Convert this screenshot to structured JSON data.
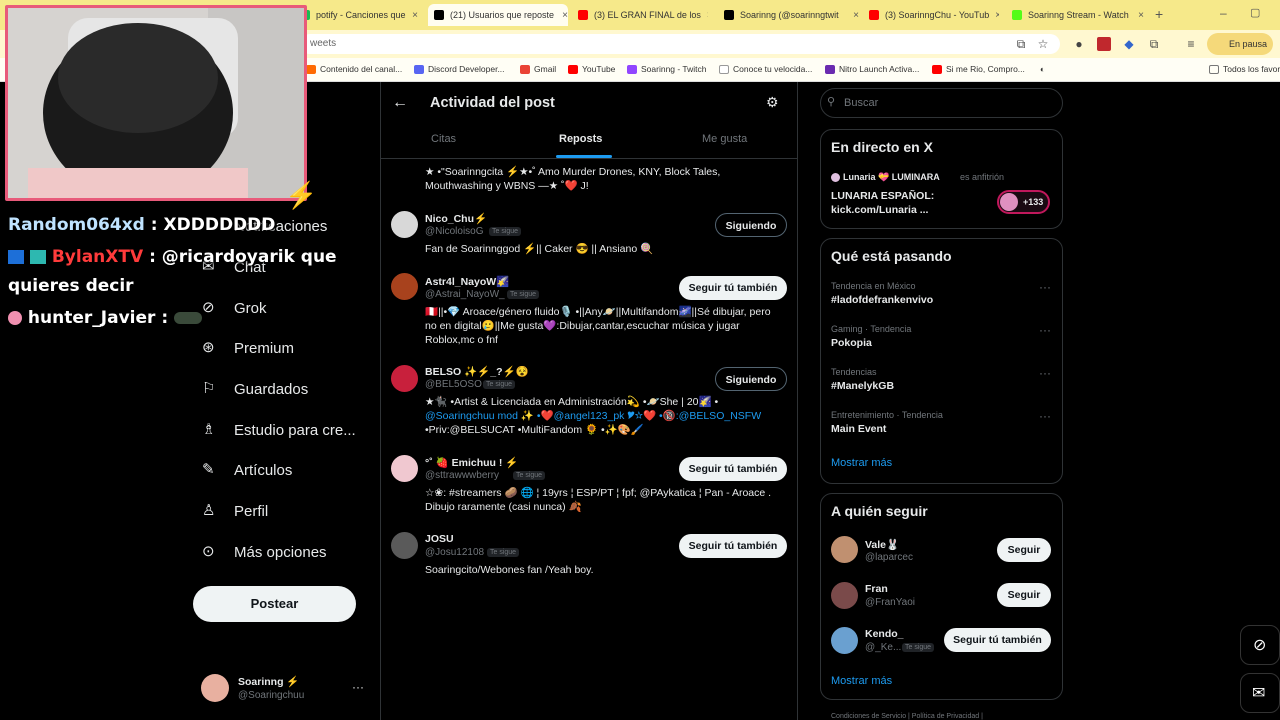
{
  "browser": {
    "tabs": [
      {
        "title": "potify - Canciones que",
        "color": "#1db954"
      },
      {
        "title": "(21) Usuarios que reposte",
        "color": "#000000"
      },
      {
        "title": "(3) EL GRAN FINAL de los",
        "color": "#ff0000"
      },
      {
        "title": "Soarinng (@soarinngtwit",
        "color": "#000000"
      },
      {
        "title": "(3) SoarinngChu - YouTub",
        "color": "#ff0000"
      },
      {
        "title": "Soarinng Stream - Watch",
        "color": "#53fc18"
      }
    ],
    "url_fragment": "weets",
    "pause_label": "En pausa",
    "bookmarks": [
      {
        "label": "Contenido del canal...",
        "color": "#ff6a00"
      },
      {
        "label": "Discord Developer...",
        "color": "#5865f2"
      },
      {
        "label": "Gmail",
        "color": "#ea4335"
      },
      {
        "label": "YouTube",
        "color": "#ff0000"
      },
      {
        "label": "Soarinng - Twitch",
        "color": "#9146ff"
      },
      {
        "label": "Conoce tu velocida...",
        "color": "#ffffff"
      },
      {
        "label": "Nitro Launch Activa...",
        "color": "#6a2bb0"
      },
      {
        "label": "Si me Rio, Compro...",
        "color": "#ff0000"
      }
    ],
    "all_favorites": "Todos los favor"
  },
  "chat": [
    {
      "user": "Random064xd",
      "text": ": XDDDDDDD",
      "color": "#bfe3ff"
    },
    {
      "user": "BylanXTV",
      "text": ": @ricardoyarik que",
      "color": "#ff3b3b"
    },
    {
      "text": "quieres decir"
    },
    {
      "user": "hunter_Javier",
      "text": ":",
      "color": "#ffffff"
    }
  ],
  "nav": {
    "items": [
      {
        "label": "Notificaciones",
        "icon": "bell-icon"
      },
      {
        "label": "Chat",
        "icon": "mail-icon"
      },
      {
        "label": "Grok",
        "icon": "grok-icon"
      },
      {
        "label": "Premium",
        "icon": "check-badge-icon"
      },
      {
        "label": "Guardados",
        "icon": "bookmark-icon"
      },
      {
        "label": "Estudio para cre...",
        "icon": "studio-icon"
      },
      {
        "label": "Artículos",
        "icon": "article-icon"
      },
      {
        "label": "Perfil",
        "icon": "person-icon"
      },
      {
        "label": "Más opciones",
        "icon": "more-circle-icon"
      }
    ],
    "post_button": "Postear",
    "account": {
      "name": "Soarinng ⚡",
      "handle": "@Soaringchuu"
    }
  },
  "middle": {
    "title": "Actividad del post",
    "tabs": [
      "Citas",
      "Reposts",
      "Me gusta"
    ],
    "partial_bio": [
      "★ •\"Soarinngcita ⚡★•˚ Amo Murder Drones, KNY, Block Tales,",
      "Mouthwashing y WBNS —★ ˚❤️ J!"
    ],
    "follows_you_label": "Te sigue",
    "users": [
      {
        "name": "Nico_Chu⚡",
        "handle": "@NicoloisoG",
        "bio": [
          "Fan de Soarinnggod ⚡|| Caker 😎 || Ansiano 🍭"
        ],
        "button": "Siguiendo",
        "color": "#d8d8d8"
      },
      {
        "name": "Astr4l_NayoW🌠",
        "handle": "@Astrai_NayoW_",
        "bio": [
          "🇵🇪||•💎 Aroace/género fluido🎙️ •||Any🪐||Multifandom🌌||Sé dibujar, pero",
          "no en digital🥲||Me gusta💜:Dibujar,cantar,escuchar música y jugar",
          "Roblox,mc o fnf"
        ],
        "button": "Seguir tú también",
        "color": "#a8421d"
      },
      {
        "name": "BELSO ✨⚡_?⚡😵",
        "handle": "@BEL5OSO",
        "bio": [
          "★🐈‍⬛ •Artist & Licenciada en Administración💫 •🪐She | 20🌠 •",
          "@Soaringchuu mod ✨ •❤️@angel123_pk 🎔☆❤️ •🔞:@BELSO_NSFW",
          "•Priv:@BELSUCAT •MultiFandom 🌻 •✨🎨🖌️"
        ],
        "button": "Siguiendo",
        "color": "#c8203c"
      },
      {
        "name": "°˚ 🍓 Emichuu ! ⚡",
        "handle": "@sttrawwwberry",
        "bio": [
          "☆❀: #streamers 🥔 🌐 ¦ 19yrs ¦ ESP/PT ¦ fpf; @PAykatica ¦ Pan - Aroace .",
          "Dibujo raramente (casi nunca) 🍂"
        ],
        "button": "Seguir tú también",
        "color": "#f0c8d0"
      },
      {
        "name": "JOSU",
        "handle": "@Josu12108",
        "bio": [
          "Soaringcito/Webones fan /Yeah boy."
        ],
        "button": "Seguir tú también",
        "color": "#5a5a5a"
      }
    ]
  },
  "right": {
    "search_placeholder": "Buscar",
    "live": {
      "title": "En directo en X",
      "host_name": "Lunaria 💝 LUMINARA",
      "host_suffix": "es anfitrión",
      "text": "LUNARIA ESPAÑOL:",
      "text2": "kick.com/Lunaria ...",
      "count": "+133"
    },
    "trends": {
      "title": "Qué está pasando",
      "items": [
        {
          "context": "Tendencia en México",
          "name": "#ladofdefrankenvivo"
        },
        {
          "context": "Gaming · Tendencia",
          "name": "Pokopia"
        },
        {
          "context": "Tendencias",
          "name": "#ManelykGB"
        },
        {
          "context": "Entretenimiento · Tendencia",
          "name": "Main Event"
        }
      ],
      "more": "Mostrar más"
    },
    "who_to_follow": {
      "title": "A quién seguir",
      "users": [
        {
          "name": "Vale🐰",
          "handle": "@laparcec",
          "button": "Seguir",
          "color": "#c09070"
        },
        {
          "name": "Fran",
          "handle": "@FranYaoi",
          "button": "Seguir",
          "color": "#7a4a4a"
        },
        {
          "name": "Kendo_",
          "handle": "@_Ke...",
          "button": "Seguir tú también",
          "color": "#6aa0d0"
        }
      ],
      "more": "Mostrar más"
    },
    "footer": "Condiciones de Servicio  |  Política de Privacidad  |"
  }
}
